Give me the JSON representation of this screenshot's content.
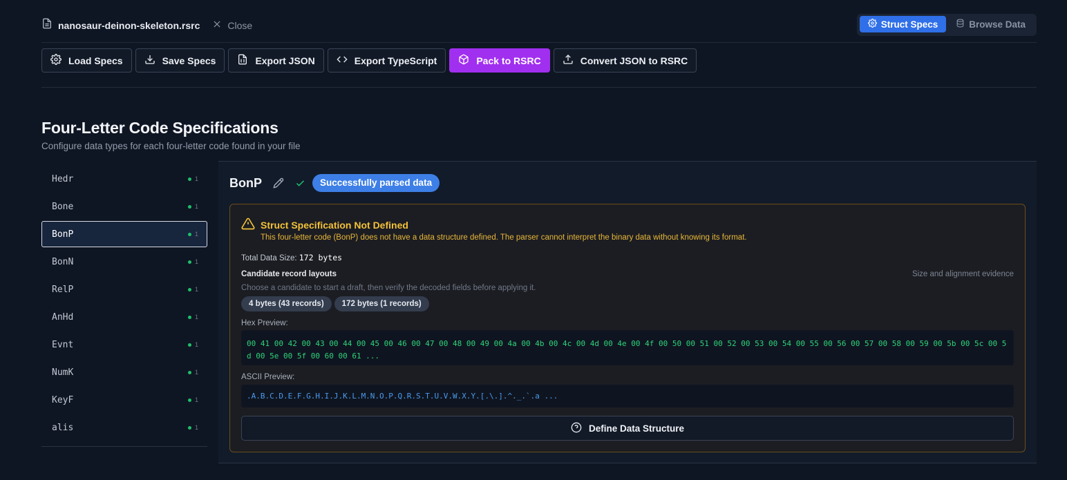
{
  "header": {
    "file_name": "nanosaur-deinon-skeleton.rsrc",
    "close_label": "Close",
    "tabs": [
      {
        "label": "Struct Specs",
        "active": true
      },
      {
        "label": "Browse Data",
        "active": false
      }
    ]
  },
  "toolbar": {
    "load_specs": "Load Specs",
    "save_specs": "Save Specs",
    "export_json": "Export JSON",
    "export_typescript": "Export TypeScript",
    "pack_to_rsrc": "Pack to RSRC",
    "convert_json": "Convert JSON to RSRC"
  },
  "page": {
    "title": "Four-Letter Code Specifications",
    "subtitle": "Configure data types for each four-letter code found in your file"
  },
  "sidebar": {
    "items": [
      {
        "code": "Hedr",
        "count": "1"
      },
      {
        "code": "Bone",
        "count": "1"
      },
      {
        "code": "BonP",
        "count": "1",
        "active": true
      },
      {
        "code": "BonN",
        "count": "1"
      },
      {
        "code": "RelP",
        "count": "1"
      },
      {
        "code": "AnHd",
        "count": "1"
      },
      {
        "code": "Evnt",
        "count": "1"
      },
      {
        "code": "NumK",
        "count": "1"
      },
      {
        "code": "KeyF",
        "count": "1"
      },
      {
        "code": "alis",
        "count": "1"
      }
    ]
  },
  "detail": {
    "code": "BonP",
    "status": "Successfully parsed data",
    "warning_title": "Struct Specification Not Defined",
    "warning_desc": "This four-letter code (BonP) does not have a data structure defined. The parser cannot interpret the binary data without knowing its format.",
    "total_size_label": "Total Data Size:",
    "total_size_value": "172 bytes",
    "candidates_title": "Candidate record layouts",
    "candidates_right": "Size and alignment evidence",
    "candidates_sub": "Choose a candidate to start a draft, then verify the decoded fields before applying it.",
    "candidates": [
      "4 bytes (43 records)",
      "172 bytes (1 records)"
    ],
    "hex_label": "Hex Preview:",
    "hex_text": "00 41 00 42 00 43 00 44 00 45 00 46 00 47 00 48 00 49 00 4a 00 4b 00 4c 00 4d 00 4e 00 4f 00 50 00 51 00 52 00 53 00 54 00 55 00 56 00 57 00 58 00 59 00 5b 00 5c 00 5d 00 5e 00 5f 00 60 00 61 ...",
    "ascii_label": "ASCII Preview:",
    "ascii_text": ".A.B.C.D.E.F.G.H.I.J.K.L.M.N.O.P.Q.R.S.T.U.V.W.X.Y.[.\\.].^._.`.a ...",
    "define_button": "Define Data Structure"
  },
  "colors": {
    "accent_blue": "#2f6fe8",
    "accent_purple": "#a12ff0",
    "status_green": "#1ec06a",
    "warning_amber": "#f3c23a"
  },
  "icons": [
    "file-icon",
    "close-icon",
    "gear-icon",
    "database-icon",
    "download-icon",
    "file-json-icon",
    "code-icon",
    "package-icon",
    "upload-icon",
    "pencil-icon",
    "check-icon",
    "warning-icon",
    "help-circle-icon"
  ]
}
